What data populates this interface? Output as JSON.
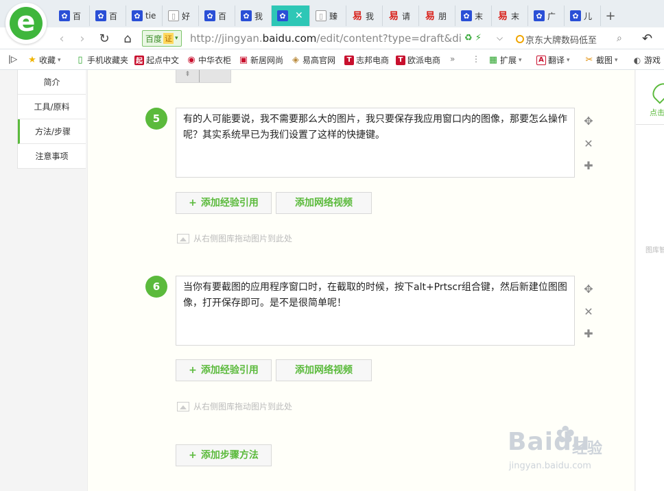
{
  "browser": {
    "tabs": [
      {
        "label": "百",
        "icon": "paw"
      },
      {
        "label": "百",
        "icon": "paw"
      },
      {
        "label": "tie",
        "icon": "paw"
      },
      {
        "label": "好",
        "icon": "doc"
      },
      {
        "label": "百",
        "icon": "paw"
      },
      {
        "label": "我",
        "icon": "paw"
      },
      {
        "label": "",
        "icon": "paw",
        "active": true
      },
      {
        "label": "臻",
        "icon": "doc"
      },
      {
        "label": "我",
        "icon": "red"
      },
      {
        "label": "请",
        "icon": "red"
      },
      {
        "label": "朋",
        "icon": "red"
      },
      {
        "label": "末",
        "icon": "paw"
      },
      {
        "label": "末",
        "icon": "red"
      },
      {
        "label": "广",
        "icon": "paw"
      },
      {
        "label": "儿",
        "icon": "paw"
      }
    ],
    "new_tab_symbol": "+",
    "security_label": "百度",
    "security_badge": "证",
    "url_prefix": "http://jingyan.",
    "url_domain": "baidu.com",
    "url_suffix": "/edit/content?type=draft&dic",
    "search_text": "京东大牌数码低至",
    "bookmarks": [
      {
        "label": "收藏",
        "icon": "star"
      },
      {
        "label": "手机收藏夹",
        "icon": "phone"
      },
      {
        "label": "起点中文",
        "icon": "qidian"
      },
      {
        "label": "中华衣柜",
        "icon": "zhonghua"
      },
      {
        "label": "新居网尚",
        "icon": "xinju"
      },
      {
        "label": "易高官网",
        "icon": "yigao"
      },
      {
        "label": "志邦电商",
        "icon": "T"
      },
      {
        "label": "欧派电商",
        "icon": "T"
      },
      {
        "label": "扩展",
        "icon": "puzzle"
      },
      {
        "label": "翻译",
        "icon": "translate"
      },
      {
        "label": "截图",
        "icon": "scissors"
      },
      {
        "label": "游戏",
        "icon": "gamepad"
      }
    ]
  },
  "outline": {
    "items": [
      "简介",
      "工具/原料",
      "方法/步骤",
      "注意事项"
    ]
  },
  "steps": [
    {
      "number": "5",
      "text": "有的人可能要说，我不需要那么大的图片，我只要保存我应用窗口内的图像，那要怎么操作呢？其实系统早已为我们设置了这样的快捷键。"
    },
    {
      "number": "6",
      "text": "当你有要截图的应用程序窗口时，在截取的时候，按下alt+Prtscr组合键，然后新建位图图像，打开保存即可。是不是很简单呢！"
    }
  ],
  "actions": {
    "plus": "+",
    "add_reference": "添加经验引用",
    "add_video": "添加网络视频",
    "drop_hint": "从右侧图库拖动图片到此处",
    "add_step": "添加步骤方法"
  },
  "right_panel": {
    "header_label": "点击",
    "library_label": "图库智"
  },
  "watermark": {
    "logo": "Baidu",
    "jingyan": "经验",
    "url": "jingyan.baidu.com"
  },
  "colors": {
    "accent_green": "#5bba3c",
    "active_tab": "#2ec7b6",
    "tab_paw_blue": "#2a4fd6"
  }
}
